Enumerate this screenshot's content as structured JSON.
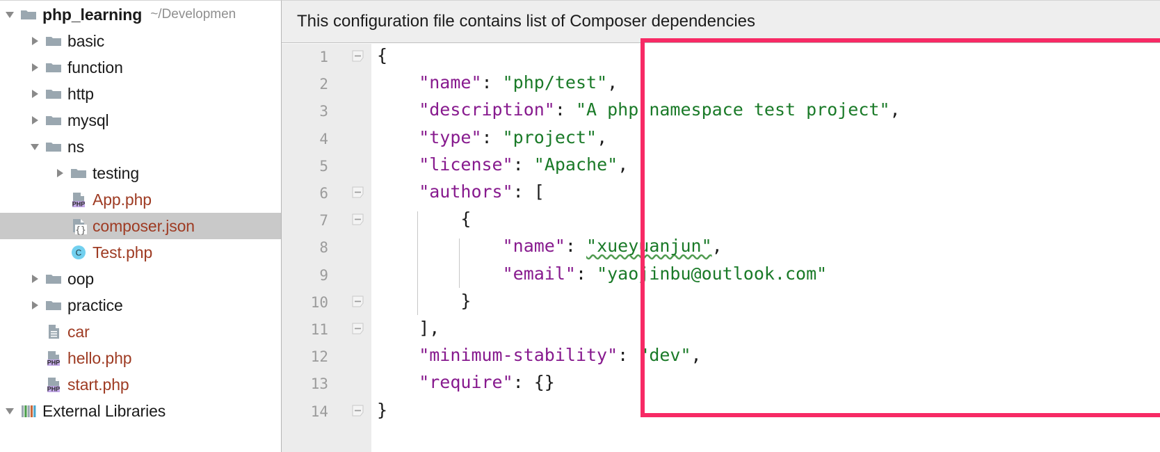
{
  "sidebar": {
    "project": {
      "name": "php_learning",
      "path": "~/Developmen",
      "icon": "folder-icon",
      "twisty": "chevron-down-icon"
    },
    "items": [
      {
        "label": "basic",
        "type": "folder",
        "icon": "folder-icon",
        "indent": 1,
        "twisty": "chevron-right-icon",
        "selected": false
      },
      {
        "label": "function",
        "type": "folder",
        "icon": "folder-icon",
        "indent": 1,
        "twisty": "chevron-right-icon",
        "selected": false
      },
      {
        "label": "http",
        "type": "folder",
        "icon": "folder-icon",
        "indent": 1,
        "twisty": "chevron-right-icon",
        "selected": false
      },
      {
        "label": "mysql",
        "type": "folder",
        "icon": "folder-icon",
        "indent": 1,
        "twisty": "chevron-right-icon",
        "selected": false
      },
      {
        "label": "ns",
        "type": "folder",
        "icon": "folder-icon",
        "indent": 1,
        "twisty": "chevron-down-icon",
        "selected": false
      },
      {
        "label": "testing",
        "type": "folder",
        "icon": "folder-icon",
        "indent": 2,
        "twisty": "chevron-right-icon",
        "selected": false
      },
      {
        "label": "App.php",
        "type": "file",
        "icon": "php-file-icon",
        "indent": 2,
        "twisty": "none",
        "selected": false
      },
      {
        "label": "composer.json",
        "type": "file",
        "icon": "json-file-icon",
        "indent": 2,
        "twisty": "none",
        "selected": true
      },
      {
        "label": "Test.php",
        "type": "file",
        "icon": "php-class-icon",
        "indent": 2,
        "twisty": "none",
        "selected": false
      },
      {
        "label": "oop",
        "type": "folder",
        "icon": "folder-icon",
        "indent": 1,
        "twisty": "chevron-right-icon",
        "selected": false
      },
      {
        "label": "practice",
        "type": "folder",
        "icon": "folder-icon",
        "indent": 1,
        "twisty": "chevron-right-icon",
        "selected": false
      },
      {
        "label": "car",
        "type": "file",
        "icon": "text-file-icon",
        "indent": 1,
        "twisty": "none",
        "selected": false
      },
      {
        "label": "hello.php",
        "type": "file",
        "icon": "php-file-icon",
        "indent": 1,
        "twisty": "none",
        "selected": false
      },
      {
        "label": "start.php",
        "type": "file",
        "icon": "php-file-icon",
        "indent": 1,
        "twisty": "none",
        "selected": false
      }
    ],
    "external_libraries": {
      "label": "External Libraries",
      "icon": "library-bars-icon",
      "twisty": "chevron-down-icon"
    }
  },
  "editor": {
    "notification": {
      "message": "This configuration file contains list of Composer dependencies"
    },
    "gutter": {
      "line_numbers": [
        "1",
        "2",
        "3",
        "4",
        "5",
        "6",
        "7",
        "8",
        "9",
        "10",
        "11",
        "12",
        "13",
        "14"
      ],
      "fold_lines": [
        1,
        6,
        7,
        10,
        11,
        14
      ]
    },
    "code": {
      "language": "json",
      "lines": [
        {
          "n": 1,
          "indent": 0,
          "segments": [
            {
              "t": "{",
              "c": "p"
            }
          ]
        },
        {
          "n": 2,
          "indent": 2,
          "segments": [
            {
              "t": "\"name\"",
              "c": "k"
            },
            {
              "t": ": ",
              "c": "p"
            },
            {
              "t": "\"php/test\"",
              "c": "s"
            },
            {
              "t": ",",
              "c": "p"
            }
          ]
        },
        {
          "n": 3,
          "indent": 2,
          "segments": [
            {
              "t": "\"description\"",
              "c": "k"
            },
            {
              "t": ": ",
              "c": "p"
            },
            {
              "t": "\"A php namespace test project\"",
              "c": "s"
            },
            {
              "t": ",",
              "c": "p"
            }
          ]
        },
        {
          "n": 4,
          "indent": 2,
          "segments": [
            {
              "t": "\"type\"",
              "c": "k"
            },
            {
              "t": ": ",
              "c": "p"
            },
            {
              "t": "\"project\"",
              "c": "s"
            },
            {
              "t": ",",
              "c": "p"
            }
          ]
        },
        {
          "n": 5,
          "indent": 2,
          "segments": [
            {
              "t": "\"license\"",
              "c": "k"
            },
            {
              "t": ": ",
              "c": "p"
            },
            {
              "t": "\"Apache\"",
              "c": "s"
            },
            {
              "t": ",",
              "c": "p"
            }
          ]
        },
        {
          "n": 6,
          "indent": 2,
          "segments": [
            {
              "t": "\"authors\"",
              "c": "k"
            },
            {
              "t": ": [",
              "c": "p"
            }
          ]
        },
        {
          "n": 7,
          "indent": 4,
          "segments": [
            {
              "t": "{",
              "c": "p"
            }
          ]
        },
        {
          "n": 8,
          "indent": 6,
          "segments": [
            {
              "t": "\"name\"",
              "c": "k"
            },
            {
              "t": ": ",
              "c": "p"
            },
            {
              "t": "\"xueyuanjun\"",
              "c": "s",
              "spell": true
            },
            {
              "t": ",",
              "c": "p"
            }
          ]
        },
        {
          "n": 9,
          "indent": 6,
          "segments": [
            {
              "t": "\"email\"",
              "c": "k"
            },
            {
              "t": ": ",
              "c": "p"
            },
            {
              "t": "\"yaojinbu@outlook.com\"",
              "c": "s"
            }
          ]
        },
        {
          "n": 10,
          "indent": 4,
          "segments": [
            {
              "t": "}",
              "c": "p"
            }
          ]
        },
        {
          "n": 11,
          "indent": 2,
          "segments": [
            {
              "t": "],",
              "c": "p"
            }
          ]
        },
        {
          "n": 12,
          "indent": 2,
          "segments": [
            {
              "t": "\"minimum-stability\"",
              "c": "k"
            },
            {
              "t": ": ",
              "c": "p"
            },
            {
              "t": "\"dev\"",
              "c": "s"
            },
            {
              "t": ",",
              "c": "p"
            }
          ]
        },
        {
          "n": 13,
          "indent": 2,
          "segments": [
            {
              "t": "\"require\"",
              "c": "k"
            },
            {
              "t": ": {}",
              "c": "p"
            }
          ]
        },
        {
          "n": 14,
          "indent": 0,
          "segments": [
            {
              "t": "}",
              "c": "p"
            }
          ]
        }
      ]
    }
  },
  "annotation": {
    "shape": "rectangle",
    "color": "#f72a65"
  },
  "colors": {
    "json_key": "#871a8e",
    "json_string": "#1a7a28",
    "punctuation": "#1a1a1a",
    "file_name": "#9e3b23",
    "folder_icon": "#9aa7b0",
    "selection": "#c9c9c9",
    "gutter_bg": "#ececec",
    "banner_bg": "#eeeeee",
    "annotation": "#f72a65"
  }
}
